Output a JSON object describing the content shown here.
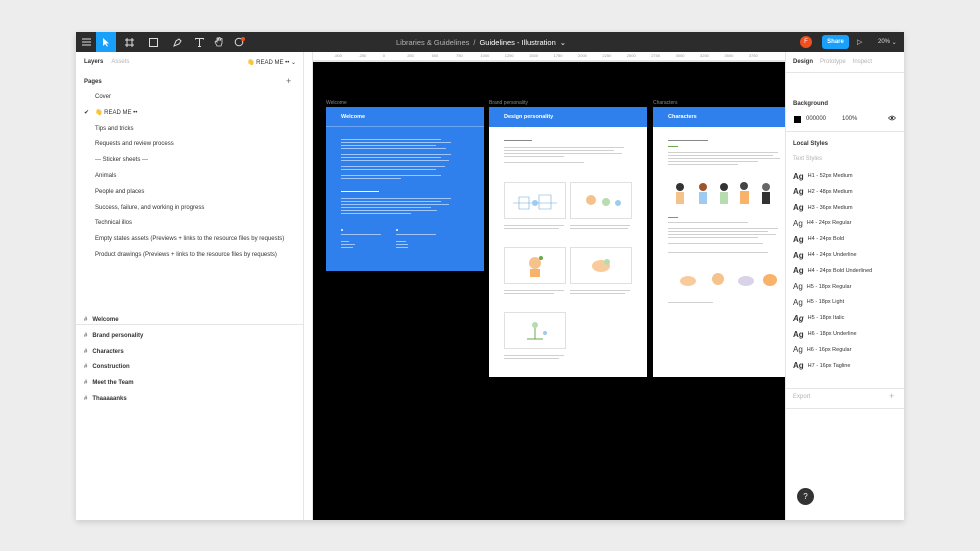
{
  "toolbar": {
    "breadcrumb_project": "Libraries & Guidelines",
    "breadcrumb_sep": "/",
    "breadcrumb_file": "Guidelines - Illustration",
    "avatar_initial": "F",
    "share_label": "Share",
    "zoom": "20%"
  },
  "left_panel": {
    "tabs": [
      "Layers",
      "Assets"
    ],
    "page_select": "👋 READ ME ••",
    "pages_header": "Pages",
    "pages": [
      {
        "label": "Cover",
        "checked": false
      },
      {
        "label": "👋 READ ME ••",
        "checked": true
      },
      {
        "label": "Tips and tricks",
        "checked": false
      },
      {
        "label": "Requests and review process",
        "checked": false
      },
      {
        "label": "--- Sticker sheets ---",
        "checked": false
      },
      {
        "label": "Animals",
        "checked": false
      },
      {
        "label": "People and places",
        "checked": false
      },
      {
        "label": "Success, failure, and working in progress",
        "checked": false
      },
      {
        "label": "Technical illos",
        "checked": false
      },
      {
        "label": "Empty states assets (Previews + links to the resource files by requests)",
        "checked": false
      },
      {
        "label": "Product drawings (Previews + links to the resource files by requests)",
        "checked": false
      }
    ],
    "layers": [
      "Welcome",
      "Brand personality",
      "Characters",
      "Construction",
      "Meet the Team",
      "Thaaaaanks"
    ]
  },
  "canvas": {
    "ruler_ticks": [
      "-500",
      "-250",
      "0",
      "250",
      "500",
      "750",
      "1000",
      "1250",
      "1500",
      "1750",
      "2000",
      "2250",
      "2500",
      "2750",
      "3000",
      "3250",
      "3500",
      "3750"
    ],
    "frames": [
      {
        "label": "Welcome",
        "title": "Welcome"
      },
      {
        "label": "Brand personality",
        "title": "Design personality"
      },
      {
        "label": "Characters",
        "title": "Characters"
      }
    ]
  },
  "right_panel": {
    "tabs": [
      "Design",
      "Prototype",
      "Inspect"
    ],
    "background_header": "Background",
    "bg_hex": "000000",
    "bg_opacity": "100%",
    "local_styles_header": "Local Styles",
    "text_styles_header": "Text Styles",
    "text_styles": [
      "H1 - 52px Medium",
      "H2 - 48px Medium",
      "H3 - 36px Medium",
      "H4 - 24px Regular",
      "H4 - 24px Bold",
      "H4 - 24px Underline",
      "H4 - 24px Bold Underlined",
      "H5 - 18px Regular",
      "H5 - 18px Light",
      "H5 - 18px Italic",
      "H6 - 18px Underline",
      "H6 - 16px Regular",
      "H7 - 16px Tagline"
    ],
    "ag_label": "Ag",
    "export_label": "Export"
  },
  "colors": {
    "accent": "#18a0fb",
    "frame_blue": "#2f80ed",
    "toolbar_bg": "#2c2c2c",
    "canvas_bg": "#000000"
  }
}
